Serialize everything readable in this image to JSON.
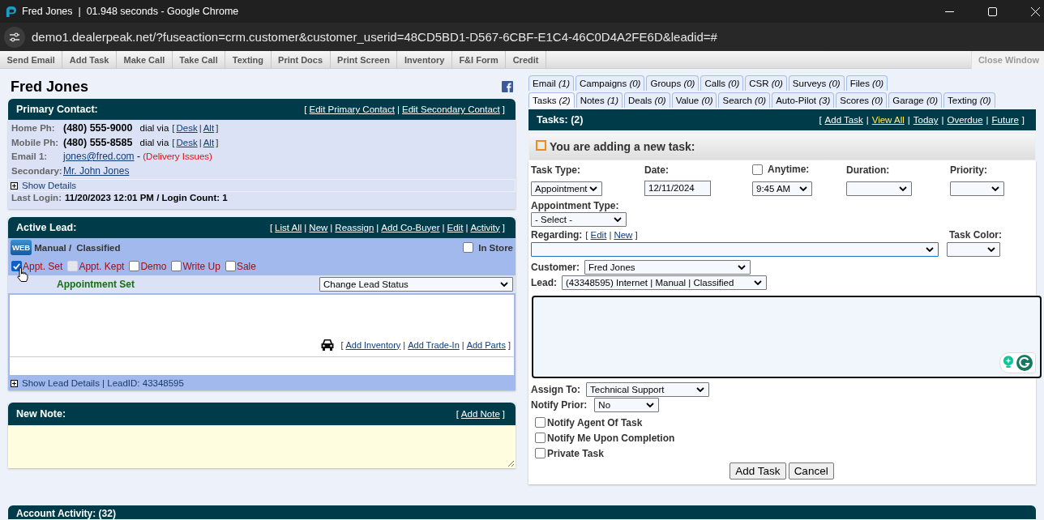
{
  "window": {
    "title": "Fred Jones  |  01.948 seconds - Google Chrome",
    "url": "demo1.dealerpeak.net/?fuseaction=crm.customer&customer_userid=48CD5BD1-D567-6CBF-E1C4-46C0D4A2FE6D&leadid=#"
  },
  "toolbar": {
    "buttons": [
      "Send Email",
      "Add Task",
      "Make Call",
      "Take Call",
      "Texting",
      "Print Docs",
      "Print Screen",
      "Inventory",
      "F&I Form",
      "Credit"
    ],
    "close_window": {
      "label": "Close Window",
      "disabled": true
    }
  },
  "punctuation": {
    "open": "[",
    "separator": "|",
    "close": "]"
  },
  "customer_name": "Fred Jones",
  "primary_contact": {
    "title": "Primary Contact:",
    "links": [
      "Edit Primary Contact",
      "Edit Secondary Contact"
    ],
    "phones": [
      {
        "label": "Home Ph:",
        "number": "(480) 555-9000",
        "dial_via": "dial via",
        "links": [
          "Desk",
          "Alt"
        ]
      },
      {
        "label": "Mobile Ph:",
        "number": "(480) 555-8585",
        "dial_via": "dial via",
        "links": [
          "Desk",
          "Alt"
        ]
      }
    ],
    "email": {
      "label": "Email 1:",
      "address": "jones@fred.com",
      "dash": "-",
      "issue": "(Delivery Issues)"
    },
    "secondary": {
      "label": "Secondary:",
      "name": "Mr. John Jones"
    },
    "show_details": "Show Details",
    "last_login": {
      "label": "Last Login:",
      "value": "11/20/2023 12:01 PM / Login Count: 1"
    }
  },
  "active_lead": {
    "title": "Active Lead:",
    "links": [
      "List All",
      "New",
      "Reassign",
      "Add Co-Buyer",
      "Edit",
      "Activity"
    ],
    "source_badge": "WEB",
    "source": "Manual /",
    "type": "Classified",
    "in_store": {
      "label": "In Store",
      "checked": false
    },
    "stages": [
      {
        "label": "Appt. Set",
        "checked": true,
        "disabled": false
      },
      {
        "label": "Appt. Kept",
        "checked": false,
        "disabled": true
      },
      {
        "label": "Demo",
        "checked": false,
        "disabled": false
      },
      {
        "label": "Write Up",
        "checked": false,
        "disabled": false
      },
      {
        "label": "Sale",
        "checked": false,
        "disabled": false
      }
    ],
    "status": "Appointment Set",
    "status_select": "Change Lead Status",
    "vehicle_links": [
      "Add Inventory",
      "Add Trade-In",
      "Add Parts"
    ],
    "details": "Show Lead Details | LeadID: 43348595"
  },
  "new_note": {
    "title": "New Note:",
    "link": "Add Note"
  },
  "tabs": [
    [
      {
        "label": "Email *(1)*",
        "selected": false
      },
      {
        "label": "Campaigns *(0)*",
        "selected": false
      },
      {
        "label": "Groups *(0)*",
        "selected": false
      },
      {
        "label": "Calls *(0)*",
        "selected": false
      },
      {
        "label": "CSR *(0)*",
        "selected": false
      },
      {
        "label": "Surveys *(0)*",
        "selected": false
      },
      {
        "label": "Files *(0)*",
        "selected": false
      }
    ],
    [
      {
        "label": "Tasks *(2)*",
        "selected": true
      },
      {
        "label": "Notes *(1)*",
        "selected": false
      },
      {
        "label": "Deals *(0)*",
        "selected": false
      },
      {
        "label": "Value *(0)*",
        "selected": false
      },
      {
        "label": "Search *(0)*",
        "selected": false
      },
      {
        "label": "Auto-Pilot *(3)*",
        "selected": false
      },
      {
        "label": "Scores *(0)*",
        "selected": false
      },
      {
        "label": "Garage *(0)*",
        "selected": false
      },
      {
        "label": "Texting *(0)*",
        "selected": false
      }
    ]
  ],
  "tasks": {
    "title": "Tasks: (2)",
    "links": [
      {
        "label": "Add Task",
        "selected": false
      },
      {
        "label": "View All",
        "selected": true
      },
      {
        "label": "Today",
        "selected": false
      },
      {
        "label": "Overdue",
        "selected": false
      },
      {
        "label": "Future",
        "selected": false
      }
    ],
    "heading": "You are adding a new task:",
    "task_type": {
      "label": "Task Type:",
      "value": "Appointment"
    },
    "date": {
      "label": "Date:",
      "value": "12/11/2024"
    },
    "anytime": {
      "label": "Anytime:",
      "checked": false
    },
    "time": {
      "value": "9:45 AM"
    },
    "duration": {
      "label": "Duration:"
    },
    "priority": {
      "label": "Priority:"
    },
    "appointment_type": {
      "label": "Appointment Type:",
      "value": "- Select -"
    },
    "regarding": {
      "label": "Regarding:",
      "links": [
        "Edit",
        "New"
      ]
    },
    "task_color": {
      "label": "Task Color:"
    },
    "customer": {
      "label": "Customer:",
      "value": "Fred Jones"
    },
    "lead": {
      "label": "Lead:",
      "value": "(43348595) Internet | Manual | Classified"
    },
    "assign_to": {
      "label": "Assign To:",
      "value": "Technical Support"
    },
    "notify_prior": {
      "label": "Notify Prior:",
      "value": "No"
    },
    "options": [
      {
        "label": "Notify Agent Of Task",
        "checked": false
      },
      {
        "label": "Notify Me Upon Completion",
        "checked": false
      },
      {
        "label": "Private Task",
        "checked": false
      }
    ],
    "buttons": [
      "Add Task",
      "Cancel"
    ]
  },
  "account_activity": {
    "title": "Account Activity: (32)"
  }
}
